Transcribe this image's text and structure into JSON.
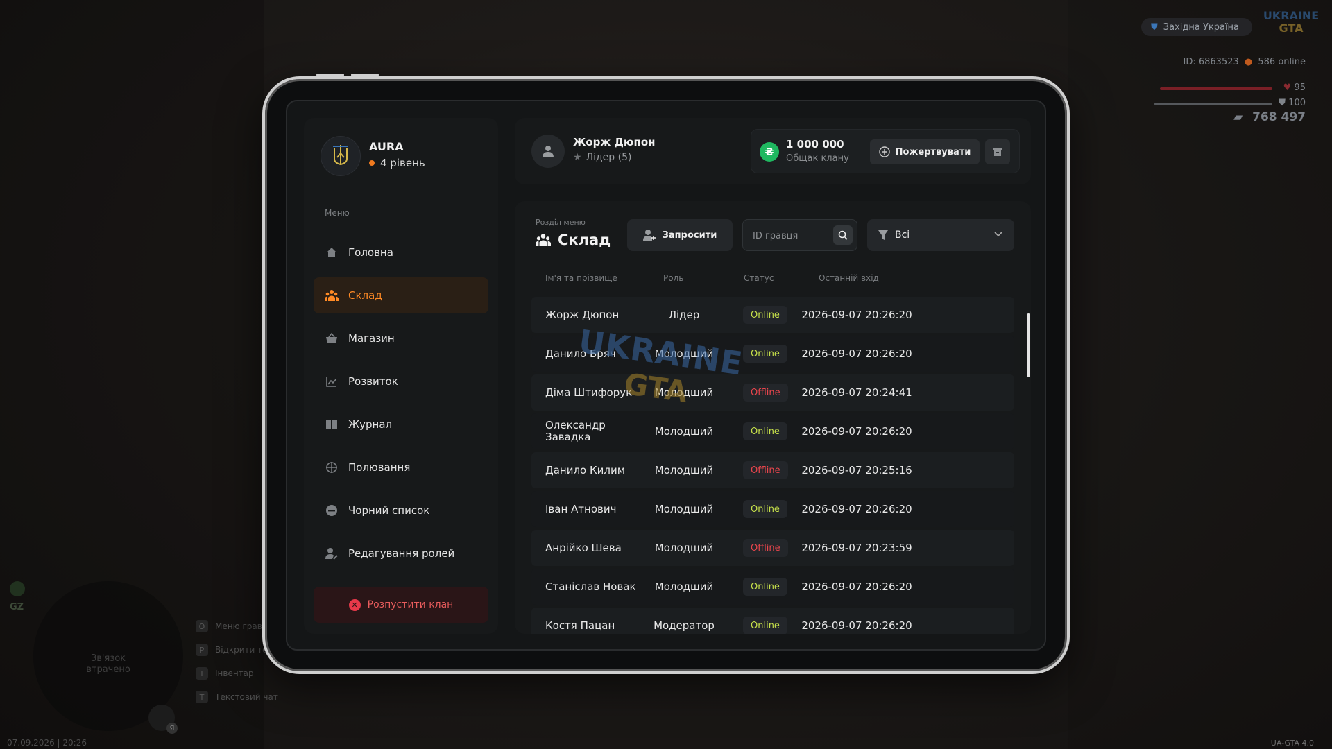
{
  "hud": {
    "region": "Західна Україна",
    "logo_line1": "UKRAINE",
    "logo_line2": "GTA",
    "id_text": "ID: 6863523",
    "online_text": "586 online",
    "health": "95",
    "armor": "100",
    "money": "768 497",
    "version": "UA-GTA 4.0",
    "datetime": "07.09.2026 | 20:26",
    "gz_label": "GZ",
    "minimap_text_line1": "Зв'язок",
    "minimap_text_line2": "втрачено",
    "hotkeys": [
      {
        "key": "O",
        "label": "Меню гравця"
      },
      {
        "key": "P",
        "label": "Відкрити телефон"
      },
      {
        "key": "I",
        "label": "Інвентар"
      },
      {
        "key": "T",
        "label": "Текстовий чат"
      }
    ],
    "mic_badge": "Я",
    "colors": {
      "health": "#c8323c",
      "armor": "#8a8d90"
    }
  },
  "clan": {
    "name": "AURA",
    "level": "4 рівень"
  },
  "sidebar": {
    "menu_title": "Меню",
    "items": [
      {
        "label": "Головна",
        "icon": "home-icon"
      },
      {
        "label": "Склад",
        "icon": "people-icon"
      },
      {
        "label": "Магазин",
        "icon": "basket-icon"
      },
      {
        "label": "Розвиток",
        "icon": "chart-icon"
      },
      {
        "label": "Журнал",
        "icon": "book-icon"
      },
      {
        "label": "Полювання",
        "icon": "target-icon"
      },
      {
        "label": "Чорний список",
        "icon": "block-icon"
      },
      {
        "label": "Редагування ролей",
        "icon": "user-edit-icon"
      }
    ],
    "active_index": 1,
    "disband_label": "Розпустити клан"
  },
  "user": {
    "name": "Жорж Дюпон",
    "role": "Лідер (5)"
  },
  "bank": {
    "amount": "1 000 000",
    "label": "Общак клану",
    "donate_label": "Пожертвувати"
  },
  "main": {
    "section_subtitle": "Розділ меню",
    "section_title": "Склад",
    "invite_label": "Запросити",
    "search_placeholder": "ID гравця",
    "filter_value": "Всі",
    "columns": [
      "Ім'я та прізвище",
      "Роль",
      "Статус",
      "Останній вхід"
    ],
    "members": [
      {
        "name": "Жорж Дюпон",
        "role": "Лідер",
        "status": "Online",
        "last": "2026-09-07 20:26:20"
      },
      {
        "name": "Данило Бряч",
        "role": "Молодший",
        "status": "Online",
        "last": "2026-09-07 20:26:20"
      },
      {
        "name": "Діма Штифорук",
        "role": "Молодший",
        "status": "Offline",
        "last": "2026-09-07 20:24:41"
      },
      {
        "name": "Олександр Завадка",
        "role": "Молодший",
        "status": "Online",
        "last": "2026-09-07 20:26:20"
      },
      {
        "name": "Данило Килим",
        "role": "Молодший",
        "status": "Offline",
        "last": "2026-09-07 20:25:16"
      },
      {
        "name": "Іван Атнович",
        "role": "Молодший",
        "status": "Online",
        "last": "2026-09-07 20:26:20"
      },
      {
        "name": "Анрійко Шева",
        "role": "Молодший",
        "status": "Offline",
        "last": "2026-09-07 20:23:59"
      },
      {
        "name": "Станіслав Новак",
        "role": "Молодший",
        "status": "Online",
        "last": "2026-09-07 20:26:20"
      },
      {
        "name": "Костя Пацан",
        "role": "Модератор",
        "status": "Online",
        "last": "2026-09-07 20:26:20"
      }
    ],
    "colors": {
      "online": "#c6e04a",
      "offline": "#e8454c",
      "accent": "#ff8a25"
    }
  },
  "watermark": {
    "line1": "UKRAINE",
    "line2": "GTA"
  }
}
